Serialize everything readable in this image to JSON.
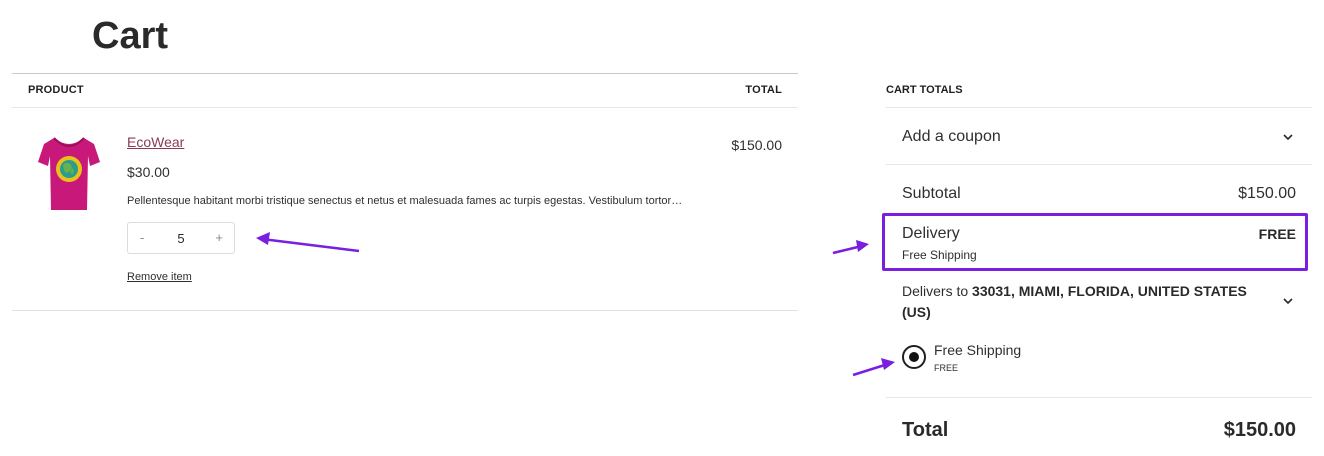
{
  "page": {
    "title": "Cart"
  },
  "cart_table": {
    "header_product": "PRODUCT",
    "header_total": "TOTAL",
    "item": {
      "name": "EcoWear",
      "price": "$30.00",
      "description": "Pellentesque habitant morbi tristique senectus et netus et malesuada fames ac turpis egestas. Vestibulum tortor…",
      "quantity": "5",
      "qty_minus": "-",
      "qty_plus": "+",
      "remove_label": "Remove item",
      "line_total": "$150.00"
    }
  },
  "totals": {
    "title": "CART TOTALS",
    "coupon_label": "Add a coupon",
    "subtotal_label": "Subtotal",
    "subtotal_value": "$150.00",
    "delivery_label": "Delivery",
    "delivery_value": "FREE",
    "delivery_method": "Free Shipping",
    "delivers_to_prefix": "Delivers to ",
    "delivers_to_address": "33031, MIAMI, FLORIDA, UNITED STATES (US)",
    "shipping_option_label": "Free Shipping",
    "shipping_option_price": "FREE",
    "total_label": "Total",
    "total_value": "$150.00"
  },
  "colors": {
    "accent": "#7a1ee0",
    "link": "#8a3a5a",
    "tshirt": "#c8187a"
  },
  "icons": [
    "chevron-down-icon",
    "radio-selected-icon",
    "annotation-arrow-icon"
  ]
}
